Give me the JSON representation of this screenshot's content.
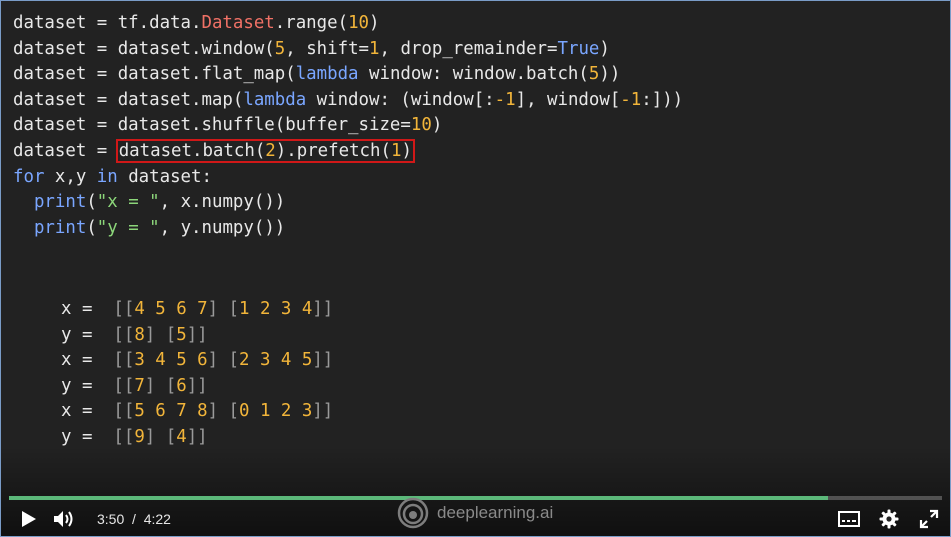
{
  "code_lines": [
    [
      [
        "dataset = tf.data.",
        ""
      ],
      [
        "Dataset",
        "red"
      ],
      [
        ".range(",
        ""
      ],
      [
        "10",
        "orange"
      ],
      [
        ")",
        ""
      ]
    ],
    [
      [
        "dataset = dataset.window(",
        ""
      ],
      [
        "5",
        "orange"
      ],
      [
        ", shift=",
        ""
      ],
      [
        "1",
        "orange"
      ],
      [
        ", drop_remainder=",
        ""
      ],
      [
        "True",
        "blue"
      ],
      [
        ")",
        ""
      ]
    ],
    [
      [
        "dataset = dataset.flat_map(",
        ""
      ],
      [
        "lambda",
        "blue"
      ],
      [
        " window: window.batch(",
        ""
      ],
      [
        "5",
        "orange"
      ],
      [
        "))",
        ""
      ]
    ],
    [
      [
        "dataset = dataset.map(",
        ""
      ],
      [
        "lambda",
        "blue"
      ],
      [
        " window: (window[:",
        ""
      ],
      [
        "-1",
        "orange"
      ],
      [
        "], window[",
        ""
      ],
      [
        "-1",
        "orange"
      ],
      [
        ":]))",
        ""
      ]
    ],
    [
      [
        "dataset = dataset.shuffle(buffer_size=",
        ""
      ],
      [
        "10",
        "orange"
      ],
      [
        ")",
        ""
      ]
    ],
    [
      [
        "dataset = ",
        ""
      ],
      [
        "dataset.batch(",
        ""
      ],
      [
        "2",
        "orange"
      ],
      [
        ").prefetch(",
        ""
      ],
      [
        "1",
        "orange"
      ],
      [
        ")",
        ""
      ]
    ],
    [
      [
        "for",
        "blue"
      ],
      [
        " x,y ",
        ""
      ],
      [
        "in",
        "blue"
      ],
      [
        " dataset:",
        ""
      ]
    ],
    [
      [
        "  ",
        ""
      ],
      [
        "print",
        "blue"
      ],
      [
        "(",
        ""
      ],
      [
        "\"x = \"",
        "green"
      ],
      [
        ", x.numpy())",
        ""
      ]
    ],
    [
      [
        "  ",
        ""
      ],
      [
        "print",
        "blue"
      ],
      [
        "(",
        ""
      ],
      [
        "\"y = \"",
        "green"
      ],
      [
        ", y.numpy())",
        ""
      ]
    ]
  ],
  "output_lines": [
    [
      [
        "x =  ",
        ""
      ],
      [
        "[[",
        "dim"
      ],
      [
        "4 5 6 7",
        "orange"
      ],
      [
        "] [",
        "dim"
      ],
      [
        "1 2 3 4",
        "orange"
      ],
      [
        "]]",
        "dim"
      ]
    ],
    [
      [
        "y =  ",
        ""
      ],
      [
        "[[",
        "dim"
      ],
      [
        "8",
        "orange"
      ],
      [
        "] [",
        "dim"
      ],
      [
        "5",
        "orange"
      ],
      [
        "]]",
        "dim"
      ]
    ],
    [
      [
        "x =  ",
        ""
      ],
      [
        "[[",
        "dim"
      ],
      [
        "3 4 5 6",
        "orange"
      ],
      [
        "] [",
        "dim"
      ],
      [
        "2 3 4 5",
        "orange"
      ],
      [
        "]]",
        "dim"
      ]
    ],
    [
      [
        "y =  ",
        ""
      ],
      [
        "[[",
        "dim"
      ],
      [
        "7",
        "orange"
      ],
      [
        "] [",
        "dim"
      ],
      [
        "6",
        "orange"
      ],
      [
        "]]",
        "dim"
      ]
    ],
    [
      [
        "x =  ",
        ""
      ],
      [
        "[[",
        "dim"
      ],
      [
        "5 6 7 8",
        "orange"
      ],
      [
        "] [",
        "dim"
      ],
      [
        "0 1 2 3",
        "orange"
      ],
      [
        "]]",
        "dim"
      ]
    ],
    [
      [
        "y =  ",
        ""
      ],
      [
        "[[",
        "dim"
      ],
      [
        "9",
        "orange"
      ],
      [
        "] [",
        "dim"
      ],
      [
        "4",
        "orange"
      ],
      [
        "]]",
        "dim"
      ]
    ]
  ],
  "player": {
    "current_time": "3:50",
    "separator": "/",
    "duration": "4:22",
    "progress_fraction": 0.878,
    "brand": "deeplearning.ai",
    "progress_color": "#5cb87a"
  },
  "icons": {
    "play": "play-icon",
    "volume": "volume-icon",
    "captions": "captions-icon",
    "settings": "gear-icon",
    "fullscreen": "fullscreen-icon",
    "logo": "deeplearning-logo-icon"
  }
}
